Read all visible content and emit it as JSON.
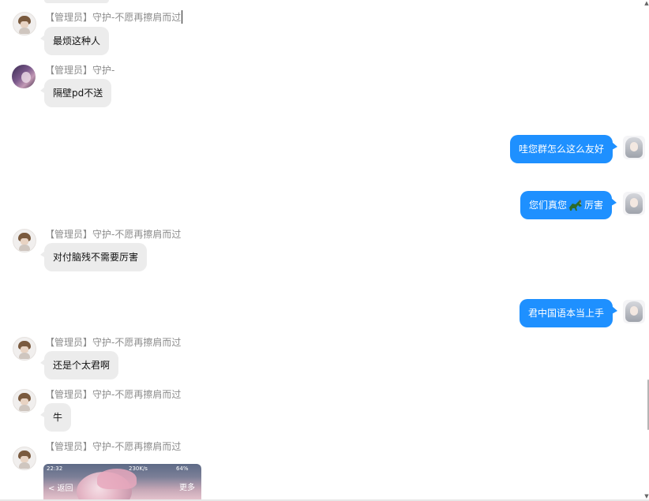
{
  "messages": [
    {
      "sender": "【管理员】守护-不愿再擦肩而过",
      "text": "最烦这种人"
    },
    {
      "sender": "【管理员】守护-",
      "text": "隔壁pd不送"
    },
    {
      "text": "哇您群怎么这么友好"
    },
    {
      "text_before": "您们真您",
      "emoji": "horse-emoji",
      "text_after": "厉害"
    },
    {
      "sender": "【管理员】守护-不愿再擦肩而过",
      "text": "对付脑残不需要厉害"
    },
    {
      "text": "君中国语本当上手"
    },
    {
      "sender": "【管理员】守护-不愿再擦肩而过",
      "text": "还是个太君啊"
    },
    {
      "sender": "【管理员】守护-不愿再擦肩而过",
      "text": "牛"
    },
    {
      "sender": "【管理员】守护-不愿再擦肩而过"
    }
  ],
  "image_message": {
    "time": "22:32",
    "net_speed": "230K/s",
    "battery": "64%",
    "back_label": "< 返回",
    "more_label": "更多"
  },
  "scrollbar": {
    "up_arrow": "▲",
    "down_arrow": "▼"
  },
  "colors": {
    "incoming_bubble": "#ececec",
    "outgoing_bubble": "#1e90ff",
    "sender_name": "#8c8c8c"
  }
}
